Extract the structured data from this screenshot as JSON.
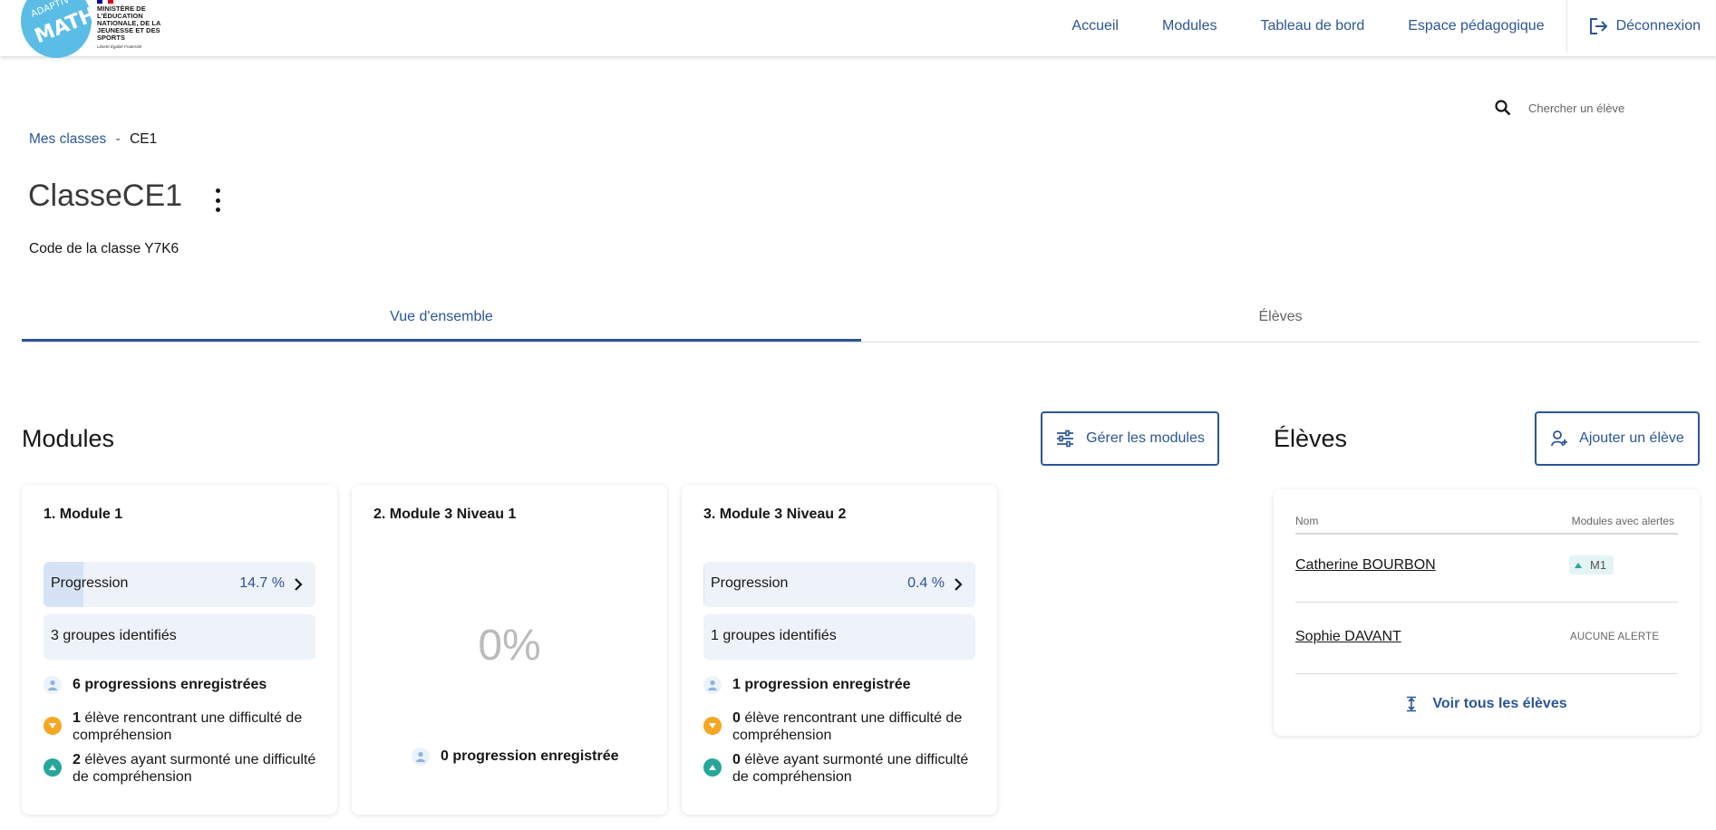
{
  "header": {
    "logo_top": "ADAPTIV'",
    "logo_main": "MATH",
    "ministry_text": "MINISTÈRE DE L'ÉDUCATION NATIONALE, DE LA JEUNESSE ET DES SPORTS",
    "ministry_motto": "Liberté Égalité Fraternité",
    "nav": {
      "accueil": "Accueil",
      "modules": "Modules",
      "tableau": "Tableau de bord",
      "espace": "Espace pédagogique",
      "logout": "Déconnexion"
    }
  },
  "search": {
    "placeholder": "Chercher un élève"
  },
  "breadcrumb": {
    "link": "Mes classes",
    "sep": "-",
    "current": "CE1"
  },
  "class": {
    "title": "ClasseCE1",
    "code": "Code de la classe Y7K6"
  },
  "tabs": {
    "overview": "Vue d'ensemble",
    "students": "Élèves"
  },
  "modules_section": {
    "title": "Modules",
    "manage_button": "Gérer les modules",
    "cards": [
      {
        "title": "1. Module 1",
        "progress_label": "Progression",
        "progress_value": "14.7 %",
        "progress_fraction": 0.147,
        "groups": "3 groupes identifiés",
        "progress_count_num": "6",
        "progress_count_text": "progressions enregistrées",
        "difficulty_num": "1",
        "difficulty_text": "élève rencontrant une difficulté de compréhension",
        "overcome_num": "2",
        "overcome_text": "élèves ayant surmonté une difficulté de compréhension"
      },
      {
        "title": "2. Module 3 Niveau 1",
        "zero": "0%",
        "progress_count_text": "0 progression enregistrée"
      },
      {
        "title": "3. Module 3 Niveau 2",
        "progress_label": "Progression",
        "progress_value": "0.4 %",
        "progress_fraction": 0.004,
        "groups": "1 groupes identifiés",
        "progress_count_num": "1",
        "progress_count_text": "progression enregistrée",
        "difficulty_num": "0",
        "difficulty_text": "élève rencontrant une difficulté de compréhension",
        "overcome_num": "0",
        "overcome_text": "élève ayant surmonté une difficulté de compréhension"
      }
    ]
  },
  "students_section": {
    "title": "Élèves",
    "add_button": "Ajouter un élève",
    "col_name": "Nom",
    "col_alerts": "Modules avec alertes",
    "rows": [
      {
        "name": "Catherine BOURBON",
        "alert": "M1"
      },
      {
        "name": "Sophie DAVANT",
        "alert": "AUCUNE ALERTE"
      }
    ],
    "see_all": "Voir tous les élèves"
  },
  "colors": {
    "primary": "#2b5597",
    "logo_blue": "#5bbde6",
    "orange": "#f5a623",
    "teal": "#26a69a"
  }
}
